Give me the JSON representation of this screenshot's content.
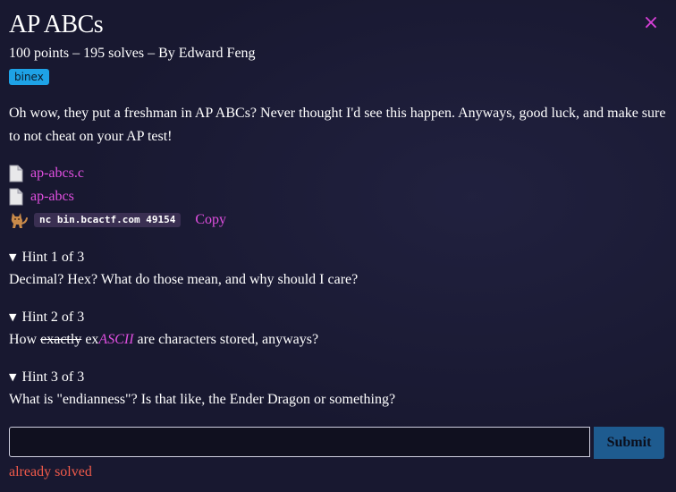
{
  "challenge": {
    "title": "AP ABCs",
    "meta": "100 points – 195 solves – By Edward Feng",
    "tag": "binex",
    "description": "Oh wow, they put a freshman in AP ABCs? Never thought I'd see this happen. Anyways, good luck, and make sure to not cheat on your AP test!"
  },
  "close_icon": "×",
  "files": [
    {
      "name": "ap-abcs.c",
      "icon": "file-icon"
    },
    {
      "name": "ap-abcs",
      "icon": "file-icon"
    }
  ],
  "connection": {
    "icon": "cat-icon",
    "command": "nc bin.bcactf.com 49154",
    "copy_label": "Copy"
  },
  "hints": [
    {
      "summary": "Hint 1 of 3",
      "text": "Decimal? Hex? What do those mean, and why should I care?"
    },
    {
      "summary": "Hint 2 of 3",
      "prefix": "How ",
      "strike": "exactly",
      "middle": " ex",
      "link": "ASCII",
      "suffix": " are characters stored, anyways?"
    },
    {
      "summary": "Hint 3 of 3",
      "text": "What is \"endianness\"? Is that like, the Ender Dragon or something?"
    }
  ],
  "flag_form": {
    "value": "",
    "placeholder": "",
    "submit_label": "Submit",
    "status": "already solved"
  },
  "colors": {
    "background": "#181830",
    "accent": "#e04fe0",
    "tag": "#1ea2e6",
    "submit": "#1e5b8f",
    "status": "#f05a4a"
  }
}
